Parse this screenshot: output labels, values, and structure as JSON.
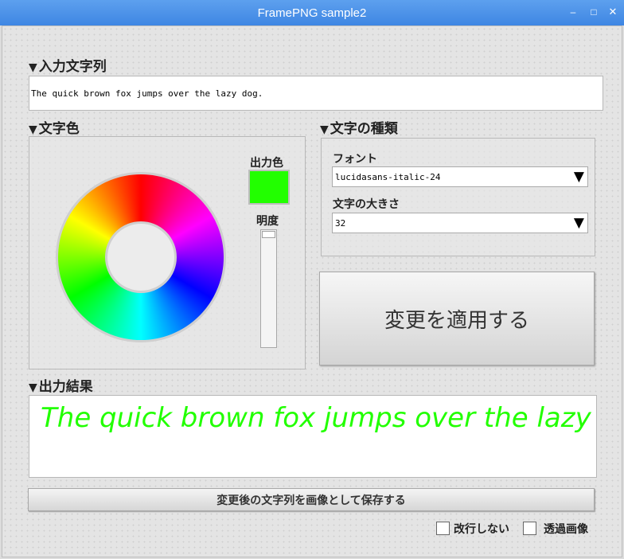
{
  "window": {
    "title": "FramePNG sample2",
    "controls": {
      "minimize": "‒",
      "maximize": "□",
      "close": "✕"
    }
  },
  "sections": {
    "input_label": "入力文字列",
    "color_label": "文字色",
    "type_label": "文字の種類",
    "output_label": "出力結果"
  },
  "input": {
    "value": "The quick brown fox jumps over the lazy dog."
  },
  "color": {
    "output_color_label": "出力色",
    "output_color": "#22ff00",
    "brightness_label": "明度"
  },
  "font_type": {
    "font_label": "フォント",
    "font_value": "lucidasans-italic-24",
    "size_label": "文字の大きさ",
    "size_value": "32"
  },
  "apply_button": "変更を適用する",
  "output": {
    "text": "The quick brown fox jumps over the lazy dog."
  },
  "save_button": "変更後の文字列を画像として保存する",
  "options": {
    "no_newline": "改行しない",
    "transparent": "透過画像"
  }
}
